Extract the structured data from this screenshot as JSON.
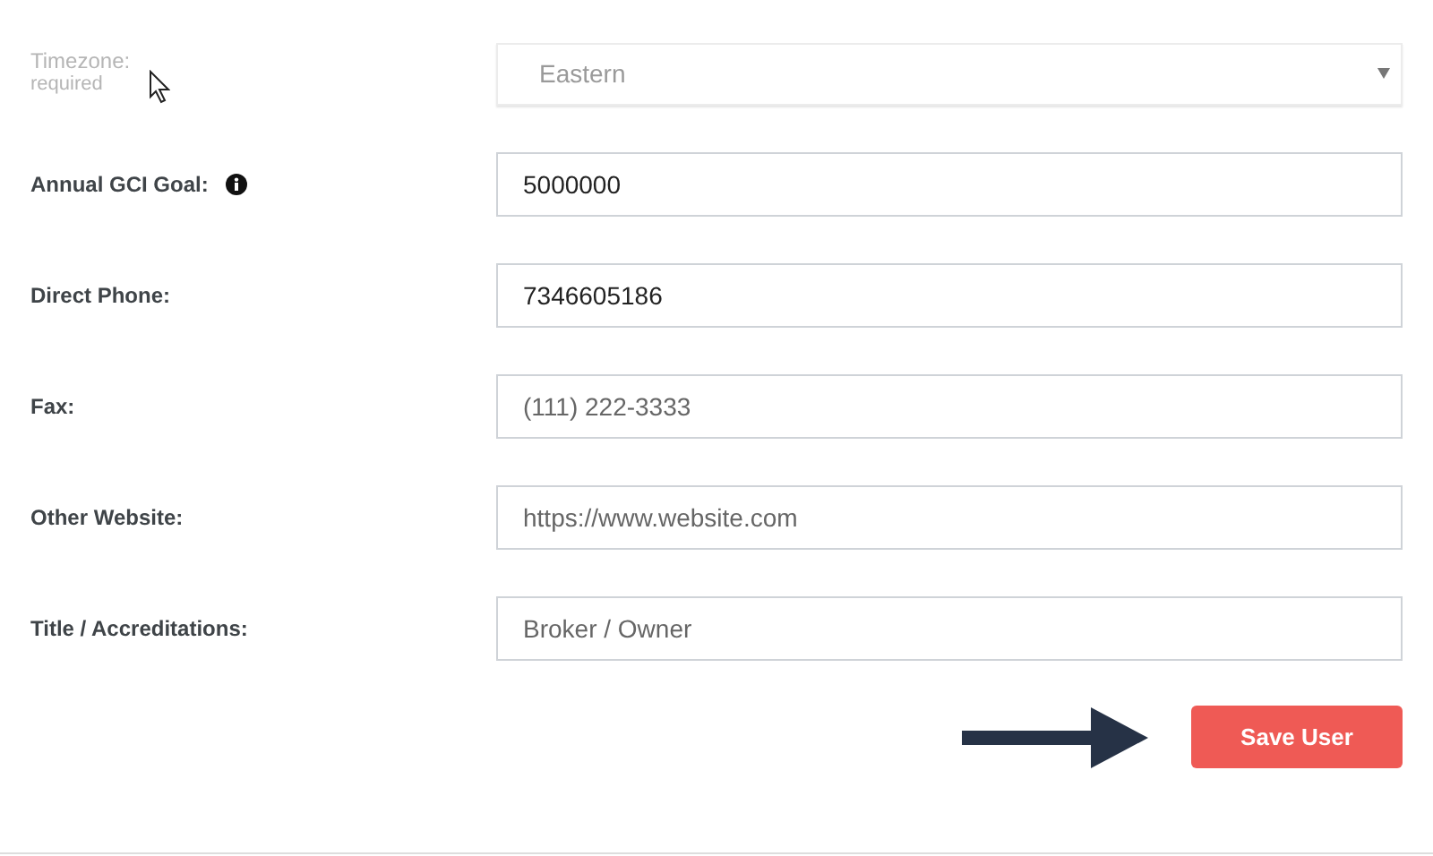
{
  "fields": [
    {
      "kind": "select",
      "label": "Timezone:",
      "sublabel": "required",
      "disabled": true,
      "value": "Eastern"
    },
    {
      "kind": "text",
      "label": "Annual GCI Goal:",
      "disabled": false,
      "info": true,
      "value": "5000000"
    },
    {
      "kind": "text",
      "label": "Direct Phone:",
      "disabled": false,
      "value": "7346605186"
    },
    {
      "kind": "text",
      "label": "Fax:",
      "disabled": false,
      "placeholder": "(111) 222-3333"
    },
    {
      "kind": "text",
      "label": "Other Website:",
      "disabled": false,
      "placeholder": "https://www.website.com"
    },
    {
      "kind": "text",
      "label": "Title / Accreditations:",
      "disabled": false,
      "placeholder": "Broker / Owner"
    }
  ],
  "save_button": "Save User"
}
